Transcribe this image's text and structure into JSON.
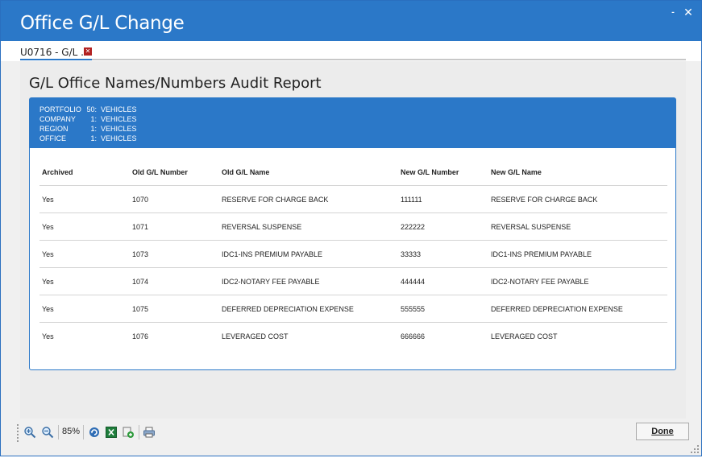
{
  "window": {
    "title": "Office G/L Change",
    "minimize": "˗",
    "close": "✕"
  },
  "tab": {
    "label": "U0716 - G/L ..."
  },
  "report": {
    "title": "G/L Office Names/Numbers Audit Report",
    "header": [
      {
        "key": "PORTFOLIO",
        "num": "50:",
        "value": "VEHICLES"
      },
      {
        "key": "COMPANY",
        "num": "1:",
        "value": "VEHICLES"
      },
      {
        "key": "REGION",
        "num": "1:",
        "value": "VEHICLES"
      },
      {
        "key": "OFFICE",
        "num": "1:",
        "value": "VEHICLES"
      }
    ],
    "columns": [
      "Archived",
      "Old G/L Number",
      "Old G/L Name",
      "New G/L Number",
      "New G/L Name"
    ],
    "rows": [
      [
        "Yes",
        "1070",
        "RESERVE FOR CHARGE BACK",
        "111111",
        "RESERVE FOR CHARGE BACK"
      ],
      [
        "Yes",
        "1071",
        "REVERSAL SUSPENSE",
        "222222",
        "REVERSAL SUSPENSE"
      ],
      [
        "Yes",
        "1073",
        "IDC1-INS PREMIUM PAYABLE",
        "33333",
        "IDC1-INS PREMIUM PAYABLE"
      ],
      [
        "Yes",
        "1074",
        "IDC2-NOTARY FEE PAYABLE",
        "444444",
        "IDC2-NOTARY FEE PAYABLE"
      ],
      [
        "Yes",
        "1075",
        "DEFERRED DEPRECIATION EXPENSE",
        "555555",
        "DEFERRED DEPRECIATION EXPENSE"
      ],
      [
        "Yes",
        "1076",
        "LEVERAGED COST",
        "666666",
        "LEVERAGED COST"
      ]
    ]
  },
  "toolbar": {
    "zoom": "85%",
    "icons": [
      "zoom-in-icon",
      "zoom-out-icon",
      "refresh-icon",
      "excel-export-icon",
      "export-icon",
      "print-icon"
    ],
    "done_label": "Done"
  },
  "colors": {
    "accent": "#2b78c8",
    "content_bg": "#ececec"
  }
}
